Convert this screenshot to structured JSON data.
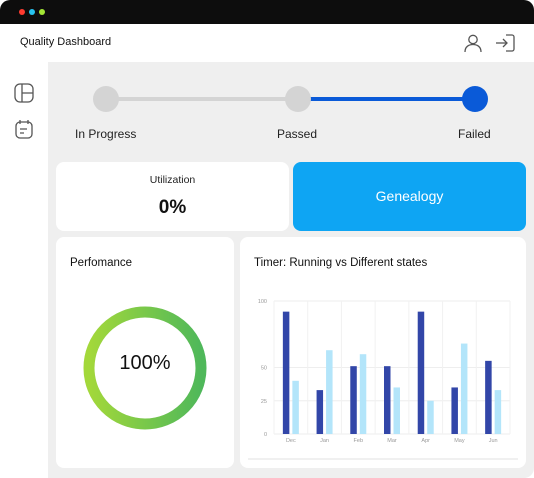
{
  "window": {
    "dots": [
      "#ff3b30",
      "#27c3f0",
      "#a3e635"
    ]
  },
  "header": {
    "title": "Quality Dashboard",
    "icons": [
      "user-icon",
      "logout-icon"
    ]
  },
  "sidebar": {
    "icons": [
      "layout-icon",
      "calendar-icon"
    ]
  },
  "status_steps": [
    {
      "label": "In Progress",
      "state": "inactive"
    },
    {
      "label": "Passed",
      "state": "inactive"
    },
    {
      "label": "Failed",
      "state": "active"
    }
  ],
  "utilization": {
    "title": "Utilization",
    "value": "0%"
  },
  "genealogy": {
    "label": "Genealogy"
  },
  "performance": {
    "title": "Perfomance",
    "value": "100%",
    "fraction": 1.0
  },
  "timer_chart": {
    "title": "Timer: Running vs Different states"
  },
  "chart_data": {
    "type": "bar",
    "categories": [
      "Dec",
      "Jan",
      "Feb",
      "Mar",
      "Apr",
      "May",
      "Jun"
    ],
    "series": [
      {
        "values": [
          92,
          33,
          51,
          51,
          92,
          35,
          55
        ]
      },
      {
        "values": [
          40,
          63,
          60,
          35,
          25,
          68,
          33
        ]
      }
    ],
    "y_ticks": [
      "0",
      "25",
      "50",
      "100"
    ],
    "ylim": [
      0,
      100
    ],
    "grid": true,
    "colors": [
      "#3246a8",
      "#b3e5fa"
    ]
  },
  "colors": {
    "accent": "#0a5ad8",
    "genealogy": "#0ea5f3",
    "inactive_node": "#d4d4d4",
    "gauge_start": "#a3d83a",
    "gauge_end": "#4fb85a"
  }
}
